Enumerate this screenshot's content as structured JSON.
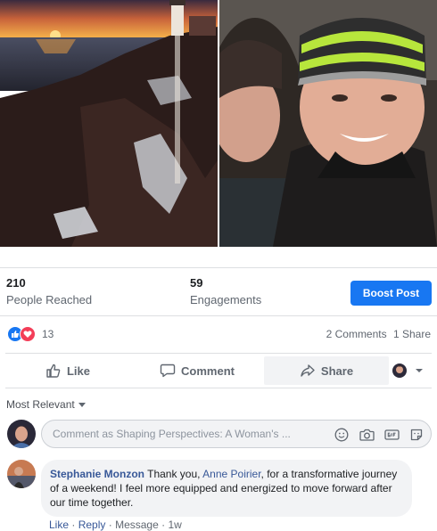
{
  "stats": {
    "reached_count": "210",
    "reached_label": "People Reached",
    "engagements_count": "59",
    "engagements_label": "Engagements",
    "boost_label": "Boost Post"
  },
  "reactions": {
    "count": "13",
    "comments": "2 Comments",
    "shares": "1 Share"
  },
  "actions": {
    "like": "Like",
    "comment": "Comment",
    "share": "Share"
  },
  "sort_label": "Most Relevant",
  "comment_input": {
    "placeholder": "Comment as Shaping Perspectives: A Woman's ..."
  },
  "comment": {
    "author": "Stephanie Monzon",
    "text_before": " Thank you, ",
    "mention": "Anne Poirier",
    "text_after": ", for a transformative journey of a weekend! I feel more equipped and energized to move forward after our time together.",
    "like": "Like",
    "reply": "Reply",
    "message": "Message",
    "time": "1w"
  },
  "colors": {
    "accent": "#1877f2",
    "link": "#385898"
  }
}
